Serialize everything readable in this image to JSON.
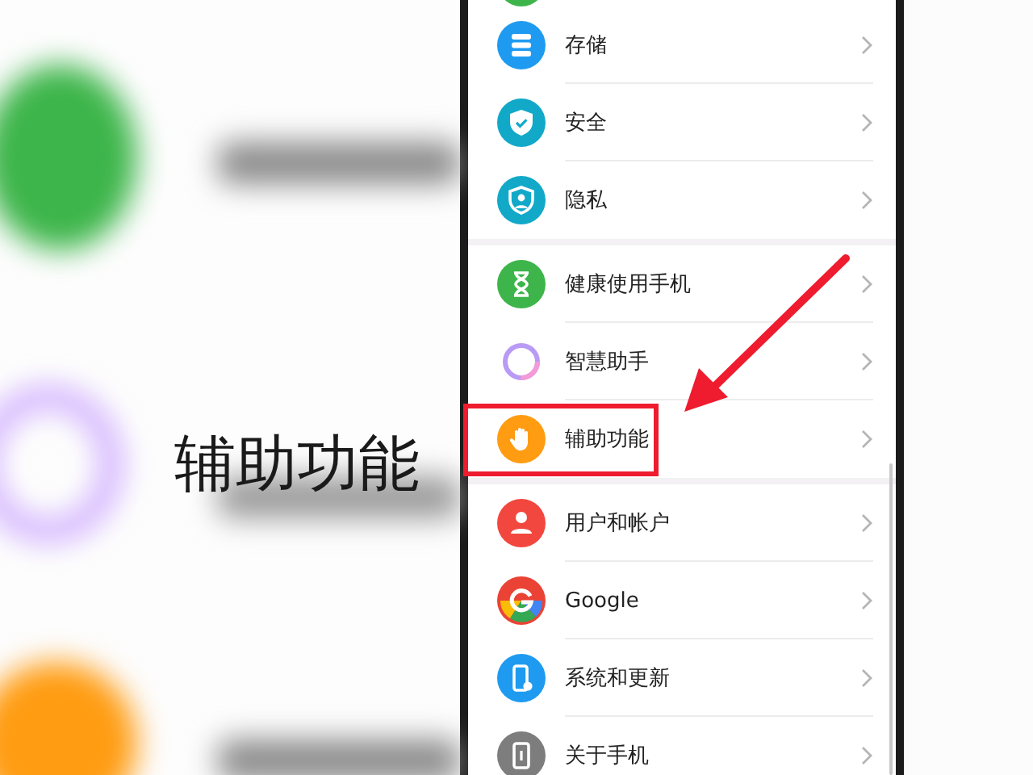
{
  "background": {
    "caption": "辅助功能"
  },
  "sections": [
    {
      "items": [
        {
          "label": "存储",
          "kind": "storage",
          "highlighted": false
        },
        {
          "label": "安全",
          "kind": "shield",
          "highlighted": false
        },
        {
          "label": "隐私",
          "kind": "privacy",
          "highlighted": false
        }
      ]
    },
    {
      "items": [
        {
          "label": "健康使用手机",
          "kind": "hourglass",
          "highlighted": false
        },
        {
          "label": "智慧助手",
          "kind": "ring",
          "highlighted": false
        },
        {
          "label": "辅助功能",
          "kind": "hand",
          "highlighted": true
        }
      ]
    },
    {
      "items": [
        {
          "label": "用户和帐户",
          "kind": "user",
          "highlighted": false
        },
        {
          "label": "Google",
          "kind": "google",
          "highlighted": false
        },
        {
          "label": "系统和更新",
          "kind": "phone",
          "highlighted": false
        },
        {
          "label": "关于手机",
          "kind": "about",
          "highlighted": false
        }
      ]
    }
  ]
}
